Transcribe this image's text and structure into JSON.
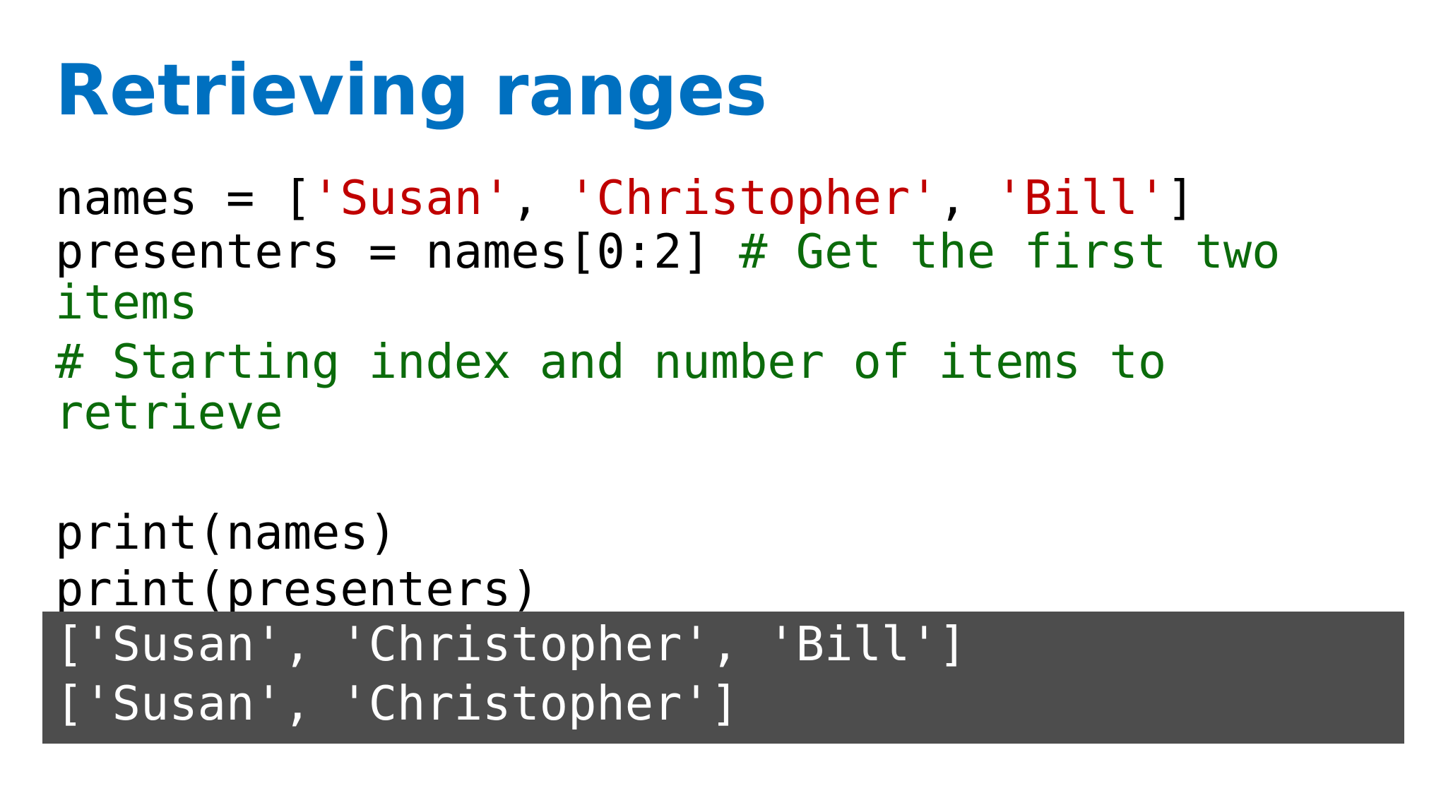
{
  "slide": {
    "title": "Retrieving ranges"
  },
  "code": {
    "line1": {
      "prefix": "names = [",
      "str1": "'Susan'",
      "sep1": ", ",
      "str2": "'Christopher'",
      "sep2": ", ",
      "str3": "'Bill'",
      "suffix": "]"
    },
    "line2": {
      "code": "presenters = names[0:2] ",
      "comment": "# Get the first two items"
    },
    "line3": {
      "comment": "# Starting index and number of items to retrieve"
    },
    "line4": {
      "code": "print(names)"
    },
    "line5": {
      "code": "print(presenters)"
    }
  },
  "output": {
    "line1": "['Susan', 'Christopher', 'Bill']",
    "line2": "['Susan', 'Christopher']"
  },
  "colors": {
    "title": "#0070c0",
    "string": "#c00000",
    "comment": "#0b6b0b",
    "output_background": "#4d4d4d",
    "output_text": "#ffffff"
  }
}
